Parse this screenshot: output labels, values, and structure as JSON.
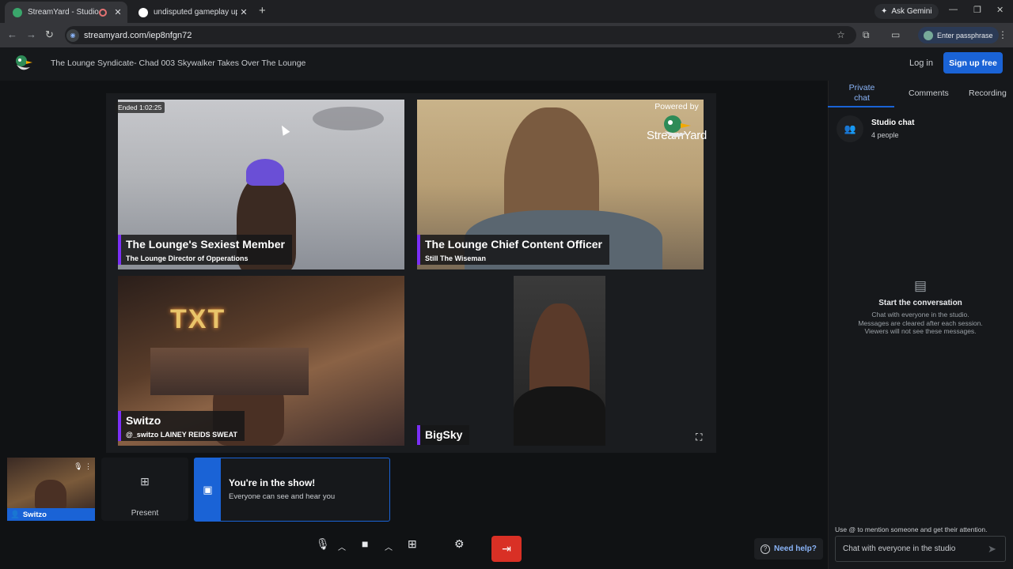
{
  "browser": {
    "tabs": [
      {
        "title": "StreamYard - Studio",
        "active": true
      },
      {
        "title": "undisputed gameplay updated",
        "active": false
      }
    ],
    "new_tab": "+",
    "ask_gemini": "Ask Gemini",
    "url": "streamyard.com/iep8nfgn72",
    "passphrase_button": "Enter passphrase"
  },
  "header": {
    "title": "The Lounge Syndicate- Chad 003 Skywalker Takes Over The Lounge",
    "login": "Log in",
    "signup": "Sign up free"
  },
  "stage": {
    "ended_badge": "Ended 1:02:25",
    "powered_by": "Powered by",
    "powered_brand": "StreamYard",
    "tiles": [
      {
        "name": "The Lounge's Sexiest Member",
        "subtitle": "The Lounge Director of Opperations"
      },
      {
        "name": "The Lounge Chief Content Officer",
        "subtitle": "Still The Wiseman"
      },
      {
        "name": "Switzo",
        "subtitle": "@_switzo LAINEY REIDS SWEAT"
      },
      {
        "name": "BigSky",
        "subtitle": ""
      }
    ],
    "ring_text": "TXT"
  },
  "bottom": {
    "self_name": "Switzo",
    "present_label": "Present",
    "banner_title": "You're in the show!",
    "banner_text": "Everyone can see and hear you",
    "need_help": "Need help?"
  },
  "side_panel": {
    "tabs": [
      "Private chat",
      "Comments",
      "Recording"
    ],
    "room_title": "Studio chat",
    "room_count": "4 people",
    "empty_title": "Start the conversation",
    "empty_line1": "Chat with everyone in the studio.",
    "empty_line2": "Messages are cleared after each session.",
    "empty_line3": "Viewers will not see these messages.",
    "mention_hint": "Use @ to mention someone and get their attention.",
    "chat_placeholder": "Chat with everyone in the studio"
  },
  "colors": {
    "accent_blue": "#1a63d6",
    "leave_red": "#d93025",
    "name_bar_purple": "#7b2ff7"
  }
}
